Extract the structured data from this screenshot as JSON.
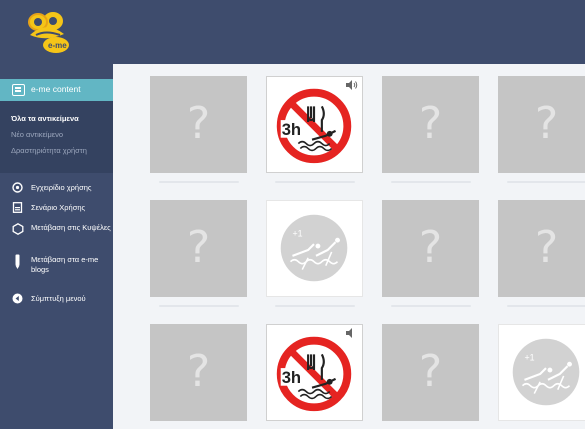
{
  "app": {
    "logo_text": "e-me"
  },
  "colors": {
    "topbar": "#3e4c6d",
    "accent": "#62b6c4",
    "card_back": "#c5c5c5",
    "prohibit_red": "#e52421"
  },
  "sidebar": {
    "header": {
      "label": "e-me content",
      "icon": "content-icon"
    },
    "sub_items": [
      {
        "label": "Όλα τα αντικείμενα",
        "active": true
      },
      {
        "label": "Νέο αντικείμενο",
        "active": false
      },
      {
        "label": "Δραστηριότητα χρήστη",
        "active": false
      }
    ],
    "items": [
      {
        "label": "Εγχειρίδιο χρήσης",
        "icon": "help-icon"
      },
      {
        "label": "Σενάριο Χρήσης",
        "icon": "document-icon"
      },
      {
        "label": "Μετάβαση στις Κυψέλες",
        "icon": "hexagon-icon"
      },
      {
        "label": "Μετάβαση στα e-me blogs",
        "icon": "pencil-icon"
      },
      {
        "label": "Σύμπτυξη μενού",
        "icon": "collapse-icon"
      }
    ]
  },
  "board": {
    "rows": [
      [
        "?",
        "3h",
        "?",
        "?"
      ],
      [
        "?",
        "+1",
        "?",
        "?"
      ],
      [
        "?",
        "3h",
        "?",
        "+1"
      ]
    ]
  }
}
